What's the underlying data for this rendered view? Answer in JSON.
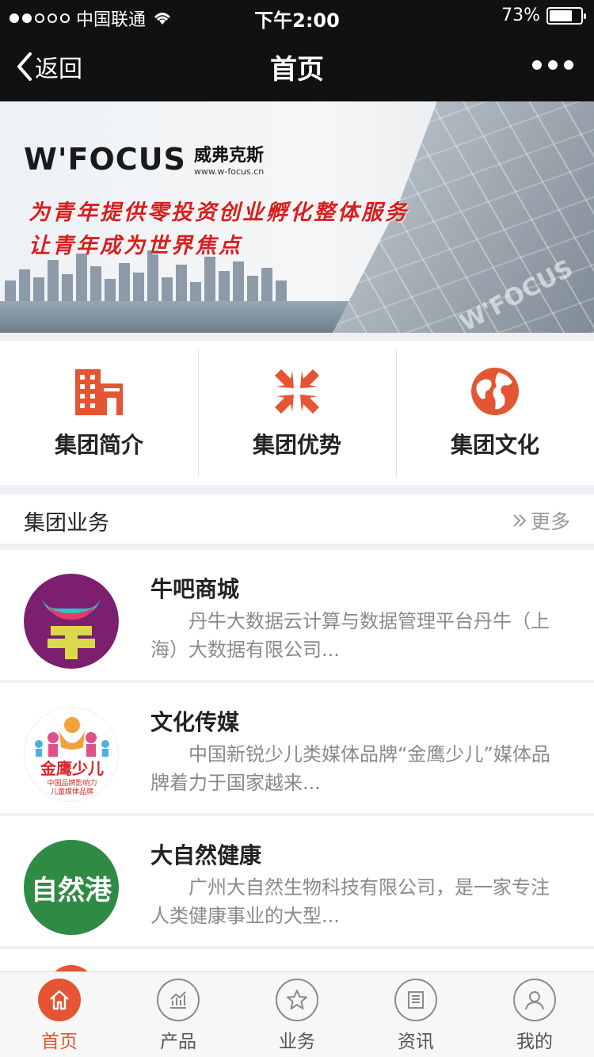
{
  "status_bar": {
    "carrier": "中国联通",
    "time": "下午2:00",
    "battery": "73%",
    "battery_level": 0.73
  },
  "nav": {
    "back_label": "返回",
    "title": "首页"
  },
  "banner": {
    "logo_text": "W'FOCUS",
    "logo_cn": "威弗克斯",
    "logo_url": "www.w-focus.cn",
    "slogan_1": "为青年提供零投资创业孵化整体服务",
    "slogan_2": "让青年成为世界焦点",
    "watermark": "W'FOCUS"
  },
  "quick_menu": [
    {
      "label": "集团简介",
      "icon": "building-icon"
    },
    {
      "label": "集团优势",
      "icon": "compress-arrows-icon"
    },
    {
      "label": "集团文化",
      "icon": "globe-icon"
    }
  ],
  "section": {
    "title": "集团业务",
    "more": "更多"
  },
  "businesses": [
    {
      "title": "牛吧商城",
      "desc": "丹牛大数据云计算与数据管理平台丹牛（上海）大数据有限公司..."
    },
    {
      "title": "文化传媒",
      "desc": "中国新锐少儿类媒体品牌“金鹰少儿”媒体品牌着力于国家越来...",
      "logo_text": "金鹰少儿",
      "logo_sub_1": "中国品牌影响力",
      "logo_sub_2": "儿童媒体品牌"
    },
    {
      "title": "大自然健康",
      "desc": "广州大自然生物科技有限公司，是一家专注人类健康事业的大型...",
      "logo_text": "自然港"
    }
  ],
  "tabbar": [
    {
      "label": "首页",
      "icon": "home-icon",
      "active": true
    },
    {
      "label": "产品",
      "icon": "chart-icon",
      "active": false
    },
    {
      "label": "业务",
      "icon": "star-icon",
      "active": false
    },
    {
      "label": "资讯",
      "icon": "news-icon",
      "active": false
    },
    {
      "label": "我的",
      "icon": "user-icon",
      "active": false
    }
  ],
  "colors": {
    "accent": "#e55533",
    "header_bg": "#111111",
    "page_bg": "#efeff4"
  }
}
